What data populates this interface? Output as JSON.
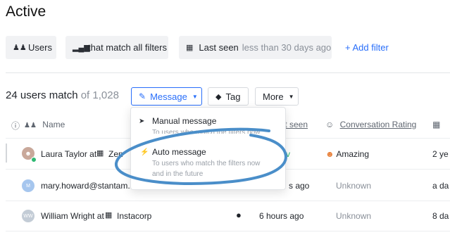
{
  "page": {
    "title": "Active"
  },
  "filters": {
    "users_label": "Users",
    "match_label": "that match all filters",
    "last_seen_label": "Last seen",
    "last_seen_value": "less than 30 days ago",
    "add_filter": "+ Add filter"
  },
  "summary": {
    "count": "24 users match",
    "total": "of 1,028"
  },
  "toolbar": {
    "message": "Message",
    "tag": "Tag",
    "more": "More"
  },
  "headers": {
    "name": "Name",
    "last_seen": "Last seen",
    "rating": "Conversation Rating"
  },
  "dropdown": {
    "manual_title": "Manual message",
    "manual_desc": "To users who match the filters now",
    "auto_title": "Auto message",
    "auto_desc_1": "To users who match the filters now",
    "auto_desc_2": "and in the future"
  },
  "rows": [
    {
      "name": "Laura Taylor at",
      "company": "Zen",
      "last_seen": "",
      "rating": "Amazing",
      "extra": "2 ye"
    },
    {
      "initial": "M",
      "name": "mary.howard@stantam.io",
      "last_seen": "s ago",
      "rating": "Unknown",
      "extra": "a da"
    },
    {
      "initial": "WW",
      "name": "William Wright at",
      "company": "Instacorp",
      "last_seen": "6 hours ago",
      "rating": "Unknown",
      "extra": "8 da"
    }
  ],
  "colors": {
    "accent": "#286efa",
    "annotation": "#4a8ec9"
  }
}
